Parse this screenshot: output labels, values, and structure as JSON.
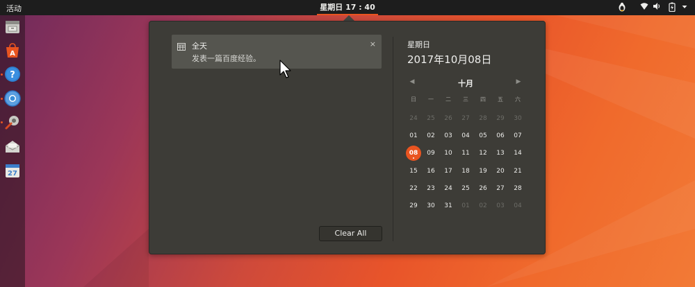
{
  "topbar": {
    "activities": "活动",
    "clock": "星期日 17 : 40"
  },
  "tray_icons": [
    "system-logo-icon",
    "wifi-icon",
    "volume-icon",
    "battery-icon",
    "dropdown-arrow-icon"
  ],
  "dock": {
    "apps": [
      {
        "name": "files-icon",
        "color": "#c9c9c4",
        "running": false
      },
      {
        "name": "software-center-icon",
        "color": "#e95420",
        "running": false
      },
      {
        "name": "help-icon",
        "color": "#2d7fcf",
        "running": true
      },
      {
        "name": "chromium-icon",
        "color": "#3a8fd9",
        "running": true
      },
      {
        "name": "tools-icon",
        "color": "#c8c8c3",
        "running": true
      },
      {
        "name": "mail-icon",
        "color": "#d4d4cf",
        "running": false
      },
      {
        "name": "calendar-app-icon",
        "color": "#3c7ecb",
        "running": false
      }
    ]
  },
  "notification": {
    "title": "全天",
    "body": "发表一篇百度经验。",
    "close": "×",
    "icon": "calendar-icon"
  },
  "clear_all_label": "Clear All",
  "calendar": {
    "weekday": "星期日",
    "date": "2017年10月08日",
    "month": "十月",
    "prev": "◀",
    "next": "▶",
    "headers": [
      "日",
      "一",
      "二",
      "三",
      "四",
      "五",
      "六"
    ],
    "weeks": [
      [
        "24",
        "25",
        "26",
        "27",
        "28",
        "29",
        "30"
      ],
      [
        "01",
        "02",
        "03",
        "04",
        "05",
        "06",
        "07"
      ],
      [
        "08",
        "09",
        "10",
        "11",
        "12",
        "13",
        "14"
      ],
      [
        "15",
        "16",
        "17",
        "18",
        "19",
        "20",
        "21"
      ],
      [
        "22",
        "23",
        "24",
        "25",
        "26",
        "27",
        "28"
      ],
      [
        "29",
        "30",
        "31",
        "01",
        "02",
        "03",
        "04"
      ]
    ],
    "today": "08"
  },
  "colors": {
    "accent": "#e95420",
    "panel": "#3d3c37",
    "topbar": "#1d1d1d"
  }
}
